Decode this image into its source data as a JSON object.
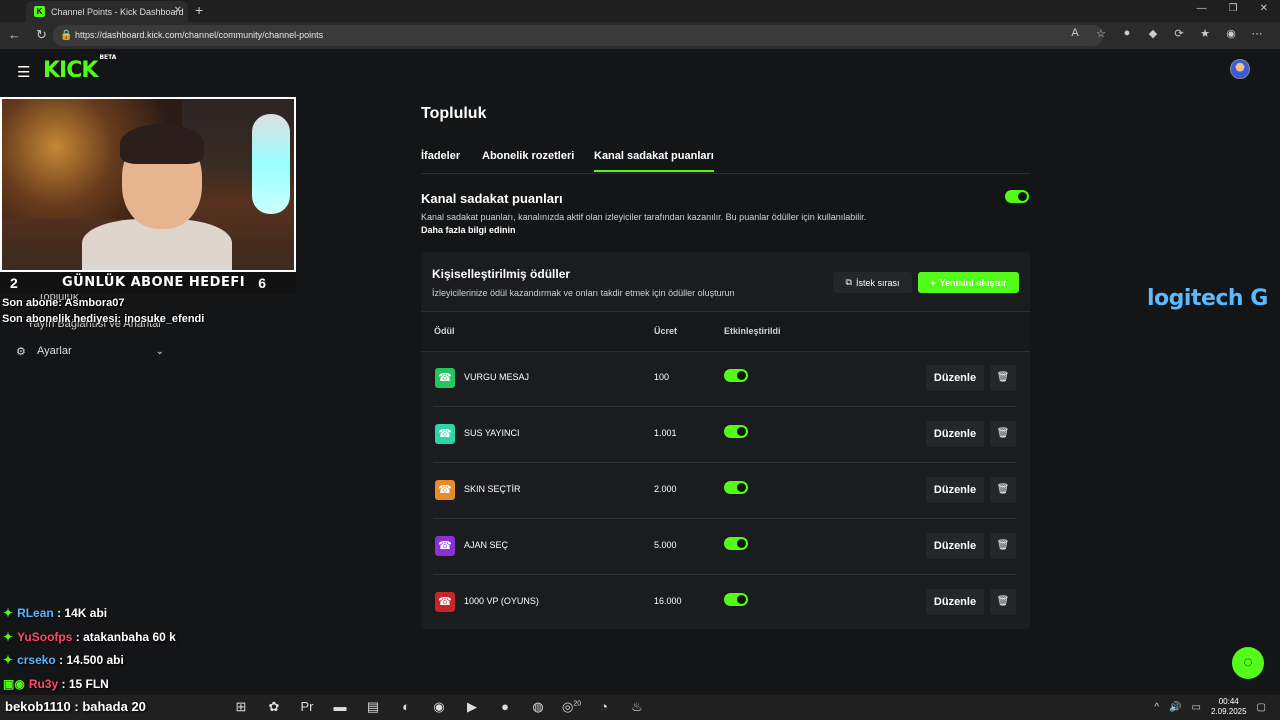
{
  "browser": {
    "tab_title": "Channel Points - Kick Dashboard",
    "tab_favicon": "K",
    "url": "https://dashboard.kick.com/channel/community/channel-points"
  },
  "header": {
    "logo": "KICK",
    "logo_badge": "BETA"
  },
  "overlay": {
    "goal_left": "2",
    "goal_title": "GÜNLÜK ABONE HEDEFI",
    "goal_right": "6",
    "last_sub": "Son abone: Asmbora07",
    "last_gift": "Son abonelik hediyesi: inosuke_efendi",
    "sidebar_ghost_1": "Topluluk",
    "sidebar_ghost_2": "Yayın Bağlantısı ve Anahtar"
  },
  "sidebar": {
    "settings_label": "Ayarlar"
  },
  "chat": [
    {
      "user": "RLean",
      "text": ": 14K abi",
      "color": "#5ab4ff"
    },
    {
      "user": "YuSoofps",
      "text": ": atakanbaha 60 k",
      "color": "#ff4a6a"
    },
    {
      "user": "crseko",
      "text": ": 14.500 abi",
      "color": "#5ab4ff"
    },
    {
      "user": "Ru3y",
      "text": ": 15 FLN",
      "color": "#ff4a6a"
    }
  ],
  "page": {
    "title": "Topluluk",
    "tabs": [
      "İfadeler",
      "Abonelik rozetleri",
      "Kanal sadakat puanları"
    ],
    "section_title": "Kanal sadakat puanları",
    "section_desc": "Kanal sadakat puanları, kanalınızda aktif olan izleyiciler tarafından kazanılır. Bu puanlar ödüller için kullanılabilir.",
    "learn_more": "Daha fazla bilgi edinin"
  },
  "rewards": {
    "title": "Kişiselleştirilmiş ödüller",
    "desc": "İzleyicilerinize ödül kazandırmak ve onları takdir etmek için ödüller oluşturun",
    "queue_button": "İstek sırası",
    "new_button": "Yenisini oluştur",
    "col_reward": "Ödül",
    "col_cost": "Ücret",
    "col_enabled": "Etkinleştirildi",
    "edit_label": "Düzenle",
    "rows": [
      {
        "name": "VURGU MESAJ",
        "cost": "100",
        "color": "#22c55e"
      },
      {
        "name": "SUS YAYINCI",
        "cost": "1.001",
        "color": "#2dd4a8"
      },
      {
        "name": "SKIN SEÇTİR",
        "cost": "2.000",
        "color": "#e8892b"
      },
      {
        "name": "AJAN SEÇ",
        "cost": "5.000",
        "color": "#8b2fd6"
      },
      {
        "name": "1000 VP (OYUNS)",
        "cost": "16.000",
        "color": "#c8242b"
      }
    ]
  },
  "sponsor": "logitech G",
  "taskbar": {
    "overlay_text": "bekob1110 : bahada 20",
    "time": "00:44",
    "date": "2.09.2025",
    "whatsapp_badge": "20"
  }
}
